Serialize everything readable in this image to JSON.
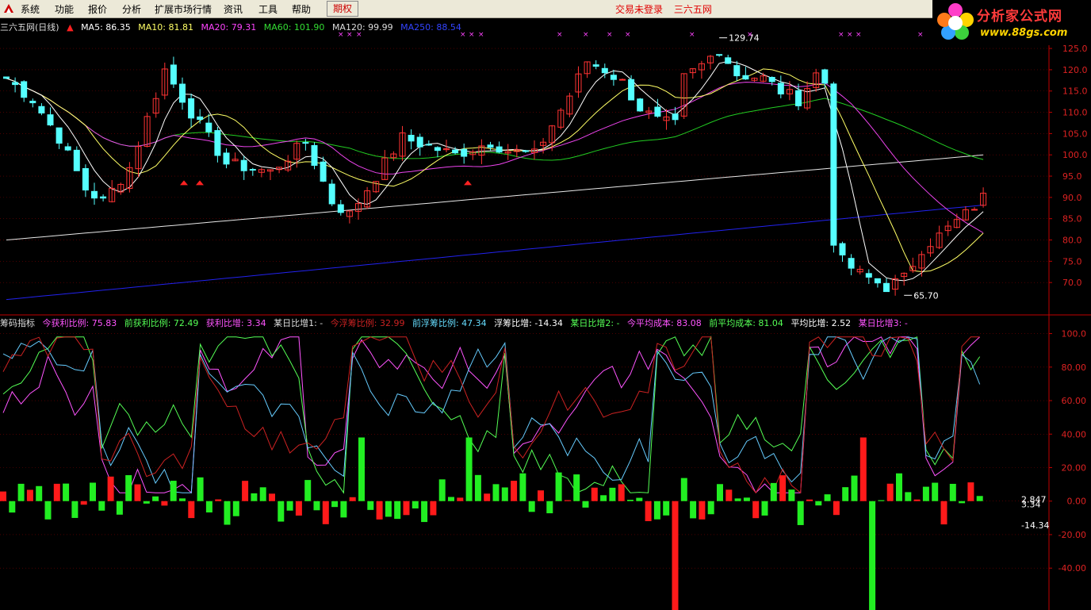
{
  "menu": {
    "items": [
      "系统",
      "功能",
      "报价",
      "分析",
      "扩展市场行情",
      "资讯",
      "工具",
      "帮助"
    ],
    "active": "期权"
  },
  "status": {
    "login": "交易未登录",
    "site": "三六五网"
  },
  "brand": {
    "name": "分析家公式网",
    "url": "www.88gs.com"
  },
  "price_panel": {
    "title": "三六五网(日线)",
    "ma": [
      {
        "label": "MA5: 86.35",
        "color": "#ffffff"
      },
      {
        "label": "MA10: 81.81",
        "color": "#ffff66"
      },
      {
        "label": "MA20: 79.31",
        "color": "#ff44ff"
      },
      {
        "label": "MA60: 101.90",
        "color": "#33dd33"
      },
      {
        "label": "MA120: 99.99",
        "color": "#dddddd"
      },
      {
        "label": "MA250: 88.54",
        "color": "#3344ff"
      }
    ],
    "high_label": "129.74",
    "low_label": "65.70",
    "axis": [
      "125.0",
      "120.0",
      "115.0",
      "110.0",
      "105.0",
      "100.0",
      "95.0",
      "90.0",
      "85.0",
      "80.0",
      "75.0",
      "70.0"
    ]
  },
  "indicator_panel": {
    "title": "筹码指标",
    "items": [
      {
        "label": "今获利比例: 75.83",
        "color": "#ff55ff"
      },
      {
        "label": "前获利比例: 72.49",
        "color": "#55ff55"
      },
      {
        "label": "获利比增: 3.34",
        "color": "#ff55ff"
      },
      {
        "label": "某日比增1: -",
        "color": "#dddddd"
      },
      {
        "label": "今浮筹比例: 32.99",
        "color": "#cc2222"
      },
      {
        "label": "前浮筹比例: 47.34",
        "color": "#66ddff"
      },
      {
        "label": "浮筹比增: -14.34",
        "color": "#ffffff"
      },
      {
        "label": "某日比增2: -",
        "color": "#55ff55"
      },
      {
        "label": "今平均成本: 83.08",
        "color": "#ff55ff"
      },
      {
        "label": "前平均成本: 81.04",
        "color": "#55ff55"
      },
      {
        "label": "平均比增: 2.52",
        "color": "#ffffff"
      },
      {
        "label": "某日比增3: -",
        "color": "#ff55ff"
      }
    ],
    "axis": [
      "100.0",
      "80.00",
      "60.00",
      "40.00",
      "20.00",
      "0.00",
      "-20.00",
      "-40.00"
    ],
    "last_labels": [
      "2.847",
      "3.34",
      "-14.34"
    ]
  },
  "chart_data": {
    "type": "candlestick",
    "ylim_price": [
      65,
      128
    ],
    "ylim_indicator": [
      -65,
      105
    ],
    "price_start": 112
  }
}
